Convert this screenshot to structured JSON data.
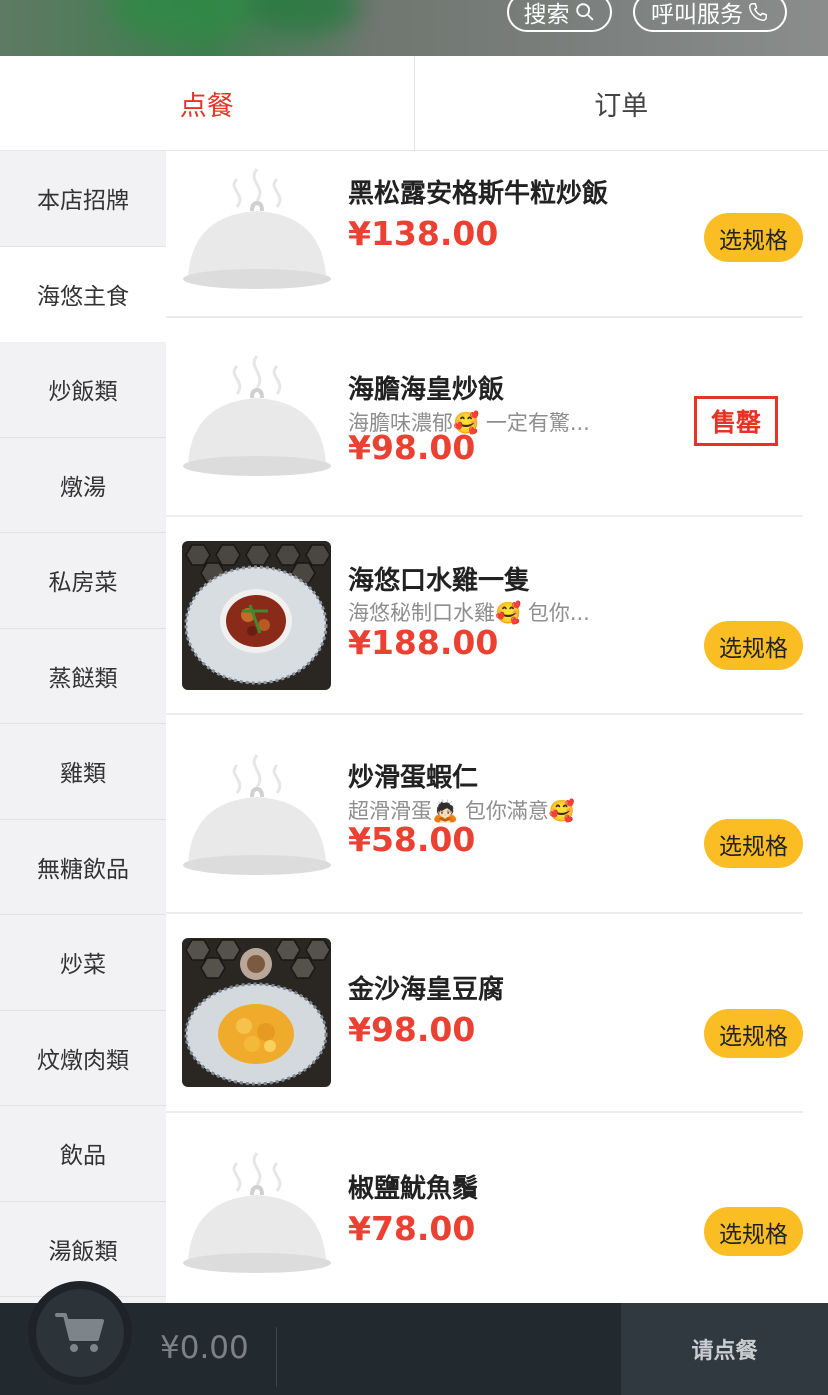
{
  "header": {
    "search_label": "搜索",
    "call_label": "呼叫服务"
  },
  "tabs": [
    {
      "label": "点餐",
      "active": true
    },
    {
      "label": "订单",
      "active": false
    }
  ],
  "sidebar": {
    "items": [
      {
        "label": "本店招牌"
      },
      {
        "label": "海悠主食",
        "active": true
      },
      {
        "label": "炒飯類"
      },
      {
        "label": "燉湯"
      },
      {
        "label": "私房菜"
      },
      {
        "label": "蒸餸類"
      },
      {
        "label": "雞類"
      },
      {
        "label": "無糖飲品"
      },
      {
        "label": "炒菜"
      },
      {
        "label": "炆燉肉類"
      },
      {
        "label": "飲品"
      },
      {
        "label": "湯飯類"
      }
    ]
  },
  "dishes": [
    {
      "name": "黑松露安格斯牛粒炒飯",
      "desc": "",
      "price": "¥138.00",
      "action": "选规格",
      "image": "placeholder-cloche-icon"
    },
    {
      "name": "海膽海皇炒飯",
      "desc": "海膽味濃郁🥰 一定有驚...",
      "price": "¥98.00",
      "action": "售罄",
      "sold_out": true,
      "image": "placeholder-cloche-icon"
    },
    {
      "name": "海悠口水雞一隻",
      "desc": "海悠秘制口水雞🥰 包你...",
      "price": "¥188.00",
      "action": "选规格",
      "image": "dish-photo-chicken"
    },
    {
      "name": "炒滑蛋蝦仁",
      "desc": "超滑滑蛋🙇🏻 包你滿意🥰",
      "price": "¥58.00",
      "action": "选规格",
      "image": "placeholder-cloche-icon"
    },
    {
      "name": "金沙海皇豆腐",
      "desc": "",
      "price": "¥98.00",
      "action": "选规格",
      "image": "dish-photo-tofu"
    },
    {
      "name": "椒鹽魷魚鬚",
      "desc": "",
      "price": "¥78.00",
      "action": "选规格",
      "image": "placeholder-cloche-icon"
    }
  ],
  "footer": {
    "total": "¥0.00",
    "checkout_label": "请点餐"
  },
  "colors": {
    "accent_red": "#e53426",
    "price_red": "#ea4132",
    "button_yellow": "#fbbd24",
    "footer_dark": "#222a30"
  }
}
